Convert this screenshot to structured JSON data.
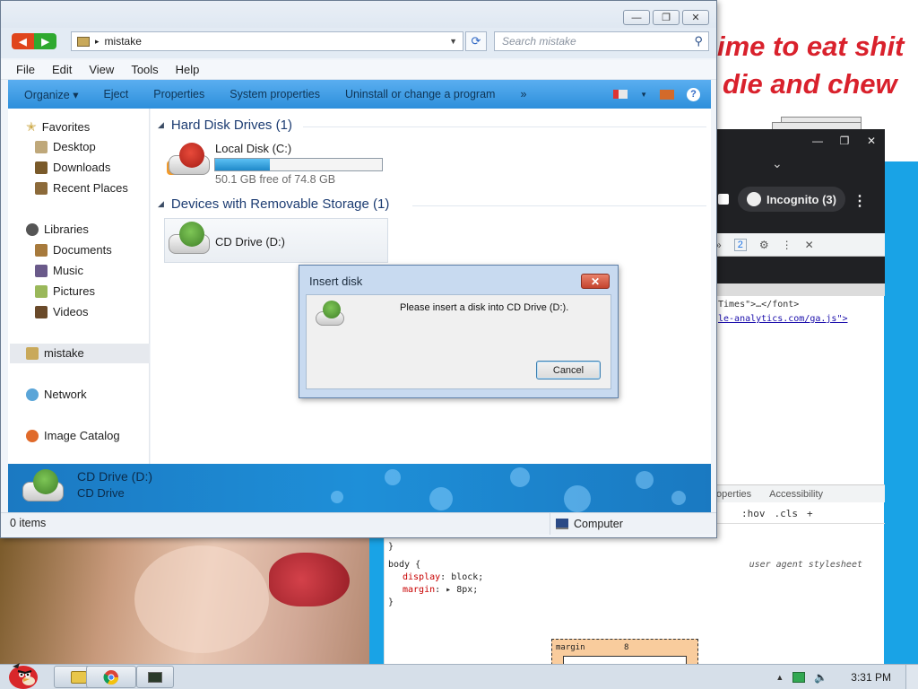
{
  "background": {
    "note_lines": [
      "ime to eat shit",
      "die and chew"
    ],
    "chrome": {
      "incognito_label": "Incognito (3)",
      "devtools_badge": "2",
      "dom_lines": [
        "Times\">…</font>",
        "le-analytics.com/ga.js\">"
      ],
      "styles_tabs": [
        "operties",
        "Accessibility"
      ],
      "filter_items": [
        ":hov",
        ".cls",
        "+"
      ]
    },
    "css_pane": {
      "close_brace_1": "}",
      "selector": "body {",
      "source": "user agent stylesheet",
      "prop_display": "display",
      "val_display": "block;",
      "prop_margin": "margin",
      "val_margin": "8px;",
      "close_brace_2": "}",
      "box_label": "margin",
      "box_value": "8"
    }
  },
  "explorer": {
    "window_controls": {
      "minimize": "—",
      "maximize": "❐",
      "close": "✕"
    },
    "address": {
      "path_segment": "mistake"
    },
    "search": {
      "placeholder": "Search mistake"
    },
    "menu": [
      "File",
      "Edit",
      "View",
      "Tools",
      "Help"
    ],
    "commands": [
      "Organize ▾",
      "Eject",
      "Properties",
      "System properties",
      "Uninstall or change a program",
      "»"
    ],
    "nav": {
      "favorites": "Favorites",
      "desktop": "Desktop",
      "downloads": "Downloads",
      "recent": "Recent Places",
      "libraries": "Libraries",
      "documents": "Documents",
      "music": "Music",
      "pictures": "Pictures",
      "videos": "Videos",
      "mistake": "mistake",
      "network": "Network",
      "image_catalog": "Image Catalog"
    },
    "groups": {
      "hdd": "Hard Disk Drives (1)",
      "removable": "Devices with Removable Storage (1)"
    },
    "local_disk": {
      "name": "Local Disk (C:)",
      "free_text": "50.1 GB free of 74.8 GB",
      "used_fraction": 0.33
    },
    "cd_drive": {
      "name": "CD Drive (D:)"
    },
    "details": {
      "title": "CD Drive (D:)",
      "subtitle": "CD Drive"
    },
    "status": {
      "items": "0 items",
      "location": "Computer"
    }
  },
  "dialog": {
    "title": "Insert disk",
    "message": "Please insert a disk into CD Drive (D:).",
    "cancel_label": "Cancel"
  },
  "taskbar": {
    "clock": "3:31 PM"
  },
  "colors": {
    "accent": "#2d8fdb",
    "desktop": "#19a3e6",
    "note_text": "#d9212c"
  }
}
